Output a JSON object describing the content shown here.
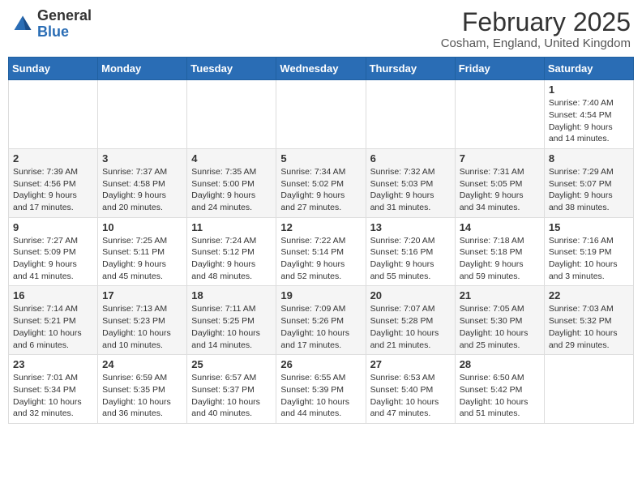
{
  "header": {
    "logo_general": "General",
    "logo_blue": "Blue",
    "month": "February 2025",
    "location": "Cosham, England, United Kingdom"
  },
  "weekdays": [
    "Sunday",
    "Monday",
    "Tuesday",
    "Wednesday",
    "Thursday",
    "Friday",
    "Saturday"
  ],
  "weeks": [
    [
      {
        "day": "",
        "info": ""
      },
      {
        "day": "",
        "info": ""
      },
      {
        "day": "",
        "info": ""
      },
      {
        "day": "",
        "info": ""
      },
      {
        "day": "",
        "info": ""
      },
      {
        "day": "",
        "info": ""
      },
      {
        "day": "1",
        "info": "Sunrise: 7:40 AM\nSunset: 4:54 PM\nDaylight: 9 hours and 14 minutes."
      }
    ],
    [
      {
        "day": "2",
        "info": "Sunrise: 7:39 AM\nSunset: 4:56 PM\nDaylight: 9 hours and 17 minutes."
      },
      {
        "day": "3",
        "info": "Sunrise: 7:37 AM\nSunset: 4:58 PM\nDaylight: 9 hours and 20 minutes."
      },
      {
        "day": "4",
        "info": "Sunrise: 7:35 AM\nSunset: 5:00 PM\nDaylight: 9 hours and 24 minutes."
      },
      {
        "day": "5",
        "info": "Sunrise: 7:34 AM\nSunset: 5:02 PM\nDaylight: 9 hours and 27 minutes."
      },
      {
        "day": "6",
        "info": "Sunrise: 7:32 AM\nSunset: 5:03 PM\nDaylight: 9 hours and 31 minutes."
      },
      {
        "day": "7",
        "info": "Sunrise: 7:31 AM\nSunset: 5:05 PM\nDaylight: 9 hours and 34 minutes."
      },
      {
        "day": "8",
        "info": "Sunrise: 7:29 AM\nSunset: 5:07 PM\nDaylight: 9 hours and 38 minutes."
      }
    ],
    [
      {
        "day": "9",
        "info": "Sunrise: 7:27 AM\nSunset: 5:09 PM\nDaylight: 9 hours and 41 minutes."
      },
      {
        "day": "10",
        "info": "Sunrise: 7:25 AM\nSunset: 5:11 PM\nDaylight: 9 hours and 45 minutes."
      },
      {
        "day": "11",
        "info": "Sunrise: 7:24 AM\nSunset: 5:12 PM\nDaylight: 9 hours and 48 minutes."
      },
      {
        "day": "12",
        "info": "Sunrise: 7:22 AM\nSunset: 5:14 PM\nDaylight: 9 hours and 52 minutes."
      },
      {
        "day": "13",
        "info": "Sunrise: 7:20 AM\nSunset: 5:16 PM\nDaylight: 9 hours and 55 minutes."
      },
      {
        "day": "14",
        "info": "Sunrise: 7:18 AM\nSunset: 5:18 PM\nDaylight: 9 hours and 59 minutes."
      },
      {
        "day": "15",
        "info": "Sunrise: 7:16 AM\nSunset: 5:19 PM\nDaylight: 10 hours and 3 minutes."
      }
    ],
    [
      {
        "day": "16",
        "info": "Sunrise: 7:14 AM\nSunset: 5:21 PM\nDaylight: 10 hours and 6 minutes."
      },
      {
        "day": "17",
        "info": "Sunrise: 7:13 AM\nSunset: 5:23 PM\nDaylight: 10 hours and 10 minutes."
      },
      {
        "day": "18",
        "info": "Sunrise: 7:11 AM\nSunset: 5:25 PM\nDaylight: 10 hours and 14 minutes."
      },
      {
        "day": "19",
        "info": "Sunrise: 7:09 AM\nSunset: 5:26 PM\nDaylight: 10 hours and 17 minutes."
      },
      {
        "day": "20",
        "info": "Sunrise: 7:07 AM\nSunset: 5:28 PM\nDaylight: 10 hours and 21 minutes."
      },
      {
        "day": "21",
        "info": "Sunrise: 7:05 AM\nSunset: 5:30 PM\nDaylight: 10 hours and 25 minutes."
      },
      {
        "day": "22",
        "info": "Sunrise: 7:03 AM\nSunset: 5:32 PM\nDaylight: 10 hours and 29 minutes."
      }
    ],
    [
      {
        "day": "23",
        "info": "Sunrise: 7:01 AM\nSunset: 5:34 PM\nDaylight: 10 hours and 32 minutes."
      },
      {
        "day": "24",
        "info": "Sunrise: 6:59 AM\nSunset: 5:35 PM\nDaylight: 10 hours and 36 minutes."
      },
      {
        "day": "25",
        "info": "Sunrise: 6:57 AM\nSunset: 5:37 PM\nDaylight: 10 hours and 40 minutes."
      },
      {
        "day": "26",
        "info": "Sunrise: 6:55 AM\nSunset: 5:39 PM\nDaylight: 10 hours and 44 minutes."
      },
      {
        "day": "27",
        "info": "Sunrise: 6:53 AM\nSunset: 5:40 PM\nDaylight: 10 hours and 47 minutes."
      },
      {
        "day": "28",
        "info": "Sunrise: 6:50 AM\nSunset: 5:42 PM\nDaylight: 10 hours and 51 minutes."
      },
      {
        "day": "",
        "info": ""
      }
    ]
  ]
}
